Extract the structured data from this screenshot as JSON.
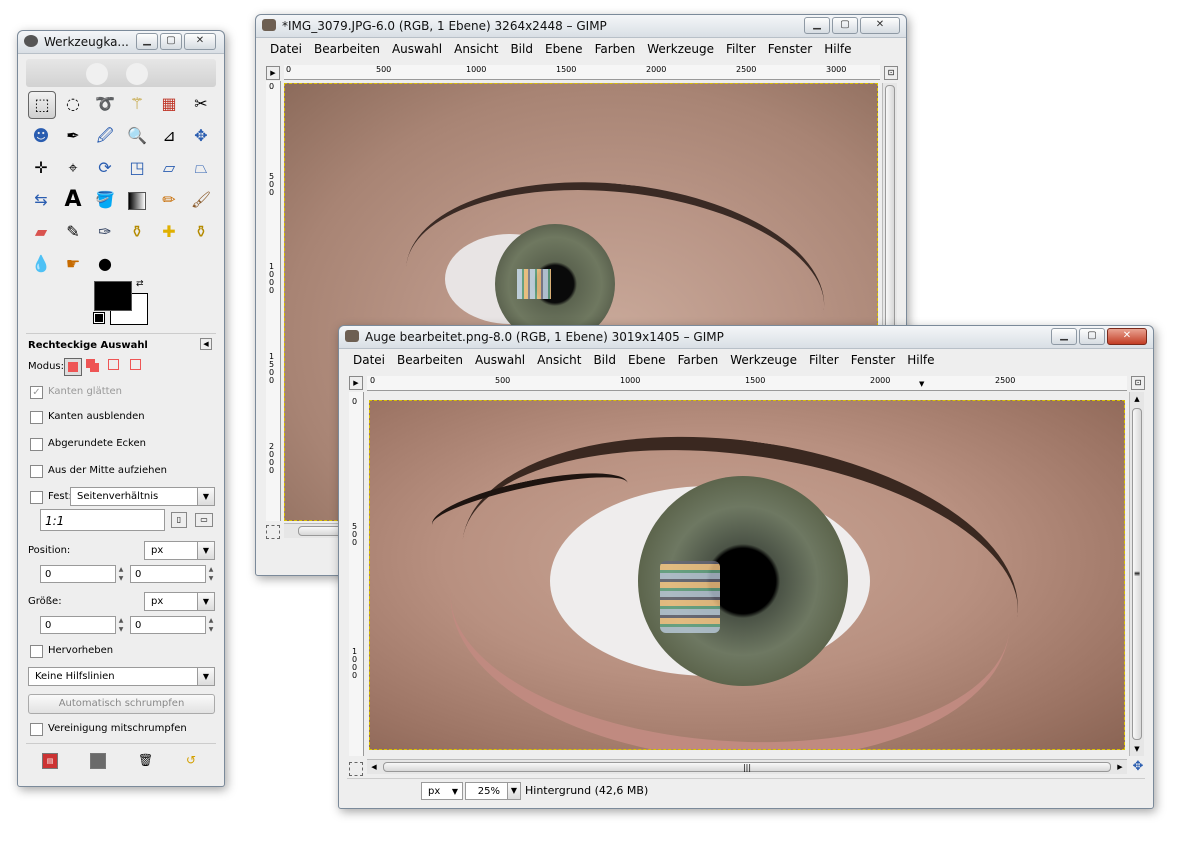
{
  "toolbox": {
    "title": "Werkzeugka...",
    "tool_options_title": "Rechteckige Auswahl",
    "mode_label": "Modus:",
    "options": {
      "antialias": "Kanten glätten",
      "feather": "Kanten ausblenden",
      "rounded": "Abgerundete Ecken",
      "from_center": "Aus der Mitte aufziehen",
      "fixed": "Fest:",
      "fixed_select": "Seitenverhältnis",
      "ratio_value": "1:1",
      "position_label": "Position:",
      "position_unit": "px",
      "position_x": "0",
      "position_y": "0",
      "size_label": "Größe:",
      "size_unit": "px",
      "size_w": "0",
      "size_h": "0",
      "highlight": "Hervorheben",
      "guides_select": "Keine Hilfslinien",
      "autoshrink_button": "Automatisch schrumpfen",
      "shrink_merged": "Vereinigung mitschrumpfen"
    }
  },
  "window1": {
    "title": "*IMG_3079.JPG-6.0 (RGB, 1 Ebene) 3264x2448 – GIMP",
    "ruler_top": [
      "0",
      "500",
      "1000",
      "1500",
      "2000",
      "2500",
      "3000"
    ],
    "ruler_left": [
      "0",
      "500",
      "1000",
      "1500",
      "2000"
    ]
  },
  "window2": {
    "title": "Auge bearbeitet.png-8.0 (RGB, 1 Ebene) 3019x1405 – GIMP",
    "ruler_top": [
      "0",
      "500",
      "1000",
      "1500",
      "2000",
      "2500"
    ],
    "ruler_left": [
      "0",
      "500",
      "1000"
    ],
    "status": {
      "unit": "px",
      "zoom": "25%",
      "layer_info": "Hintergrund (42,6 MB)"
    }
  },
  "menu": [
    "Datei",
    "Bearbeiten",
    "Auswahl",
    "Ansicht",
    "Bild",
    "Ebene",
    "Farben",
    "Werkzeuge",
    "Filter",
    "Fenster",
    "Hilfe"
  ],
  "colors": {
    "foreground": "#000000",
    "background": "#ffffff",
    "selection_marching_ants": "#d8c000"
  }
}
